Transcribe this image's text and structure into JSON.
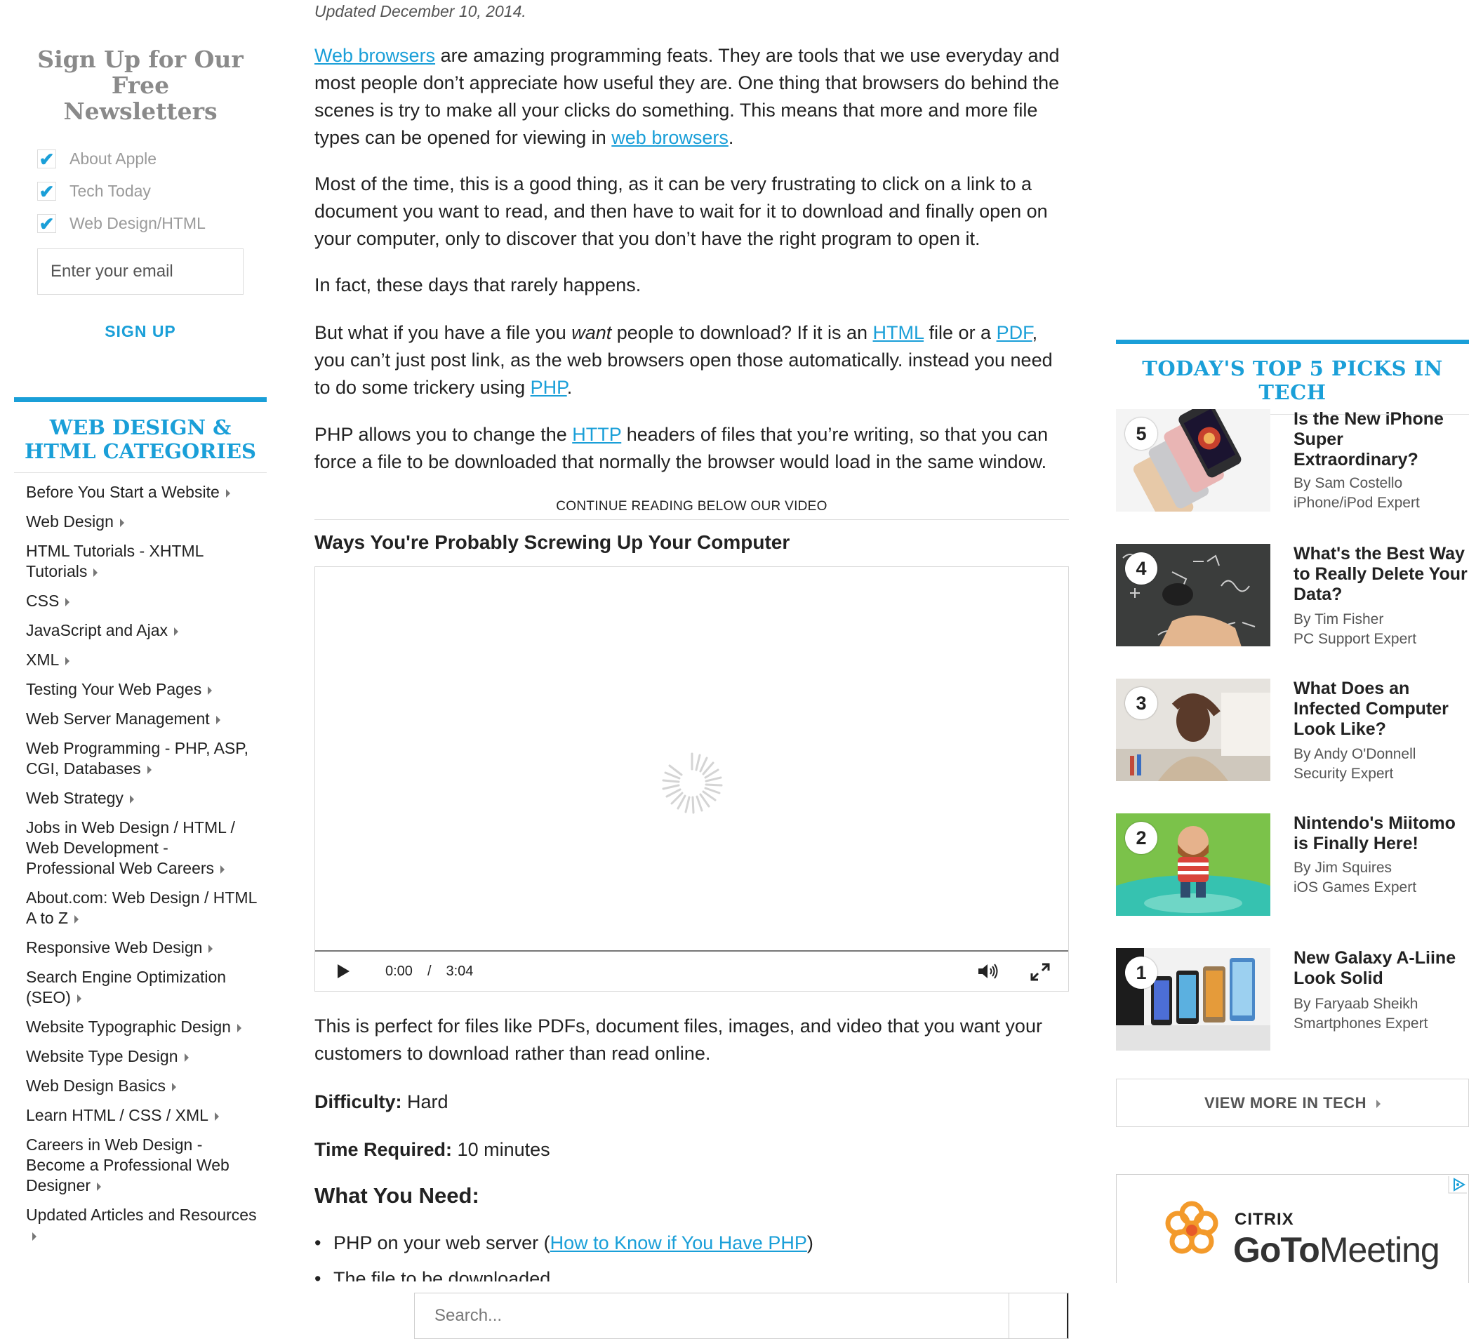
{
  "newsletter": {
    "title": "Sign Up for Our Free Newsletters",
    "options": [
      {
        "label": "About Apple",
        "checked": true
      },
      {
        "label": "Tech Today",
        "checked": true
      },
      {
        "label": "Web Design/HTML",
        "checked": true
      }
    ],
    "email_placeholder": "Enter your email",
    "signup_label": "SIGN UP"
  },
  "categories": {
    "title": "WEB DESIGN & HTML CATEGORIES",
    "items": [
      "Before You Start a Website",
      "Web Design",
      "HTML Tutorials - XHTML Tutorials",
      "CSS",
      "JavaScript and Ajax",
      "XML",
      "Testing Your Web Pages",
      "Web Server Management",
      "Web Programming - PHP, ASP, CGI, Databases",
      "Web Strategy",
      "Jobs in Web Design / HTML / Web Development - Professional Web Careers",
      "About.com: Web Design / HTML A to Z",
      "Responsive Web Design",
      "Search Engine Optimization (SEO)",
      "Website Typographic Design",
      "Website Type Design",
      "Web Design Basics",
      "Learn HTML / CSS / XML",
      "Careers in Web Design - Become a Professional Web Designer",
      "Updated Articles and Resources"
    ]
  },
  "article": {
    "updated": "Updated December 10, 2014.",
    "p1": {
      "link1": "Web browsers",
      "text1": " are amazing programming feats. They are tools that we use everyday and most people don’t appreciate how useful they are. One thing that browsers do behind the scenes is try to make all your clicks do something. This means that more and more file types can be opened for viewing in ",
      "link2": "web browsers",
      "text2": "."
    },
    "p2": "Most of the time, this is a good thing, as it can be very frustrating to click on a link to a document you want to read, and then have to wait for it to download and finally open on your computer, only to discover that you don’t have the right program to open it.",
    "p3": "In fact, these days that rarely happens.",
    "p4": {
      "text1": "But what if you have a file you ",
      "em": "want",
      "text2": " people to download? If it is an ",
      "link1": "HTML",
      "text3": " file or a ",
      "link2": "PDF",
      "text4": ", you can’t just post link, as the web browsers open those automatically. instead you need to do some trickery using ",
      "link3": "PHP",
      "text5": "."
    },
    "p5": {
      "text1": "PHP allows you to change the ",
      "link1": "HTTP",
      "text2": " headers of files that you’re writing, so that you can force a file to be downloaded that normally the browser would load in the same window."
    },
    "continue_label": "CONTINUE READING BELOW OUR VIDEO",
    "video": {
      "title": "Ways You're Probably Screwing Up Your Computer",
      "current_time": "0:00",
      "separator": "/",
      "duration": "3:04"
    },
    "p6": "This is perfect for files like PDFs, document files, images, and video that you want your customers to download rather than read online.",
    "difficulty": {
      "label": "Difficulty:",
      "value": " Hard"
    },
    "time_required": {
      "label": "Time Required:",
      "value": " 10 minutes"
    },
    "need_title": "What You Need:",
    "need_list": {
      "item1_text": "PHP on your web server (",
      "item1_link": "How to Know if You Have PHP",
      "item1_end": ")",
      "item2": "The file to be downloaded"
    }
  },
  "search": {
    "placeholder": "Search..."
  },
  "picks": {
    "title": "TODAY'S TOP 5 PICKS IN TECH",
    "items": [
      {
        "num": "5",
        "title": "Is the New iPhone Super Extraordinary?",
        "author": "By Sam Costello",
        "role": "iPhone/iPod Expert"
      },
      {
        "num": "4",
        "title": "What's the Best Way to Really Delete Your Data?",
        "author": "By Tim Fisher",
        "role": "PC Support Expert"
      },
      {
        "num": "3",
        "title": "What Does an Infected Computer Look Like?",
        "author": "By Andy O'Donnell",
        "role": "Security Expert"
      },
      {
        "num": "2",
        "title": "Nintendo's Miitomo is Finally Here!",
        "author": "By Jim Squires",
        "role": "iOS Games Expert"
      },
      {
        "num": "1",
        "title": "New Galaxy A-Liine Look Solid",
        "author": "By Faryaab Sheikh",
        "role": "Smartphones Expert"
      }
    ],
    "view_more": "VIEW MORE IN TECH"
  },
  "ad": {
    "brand_top": "CITRIX",
    "brand_bold": "GoTo",
    "brand_rest": "Meeting"
  },
  "colors": {
    "accent": "#1a9fd8",
    "text": "#222222",
    "muted": "#8a8a8a"
  }
}
